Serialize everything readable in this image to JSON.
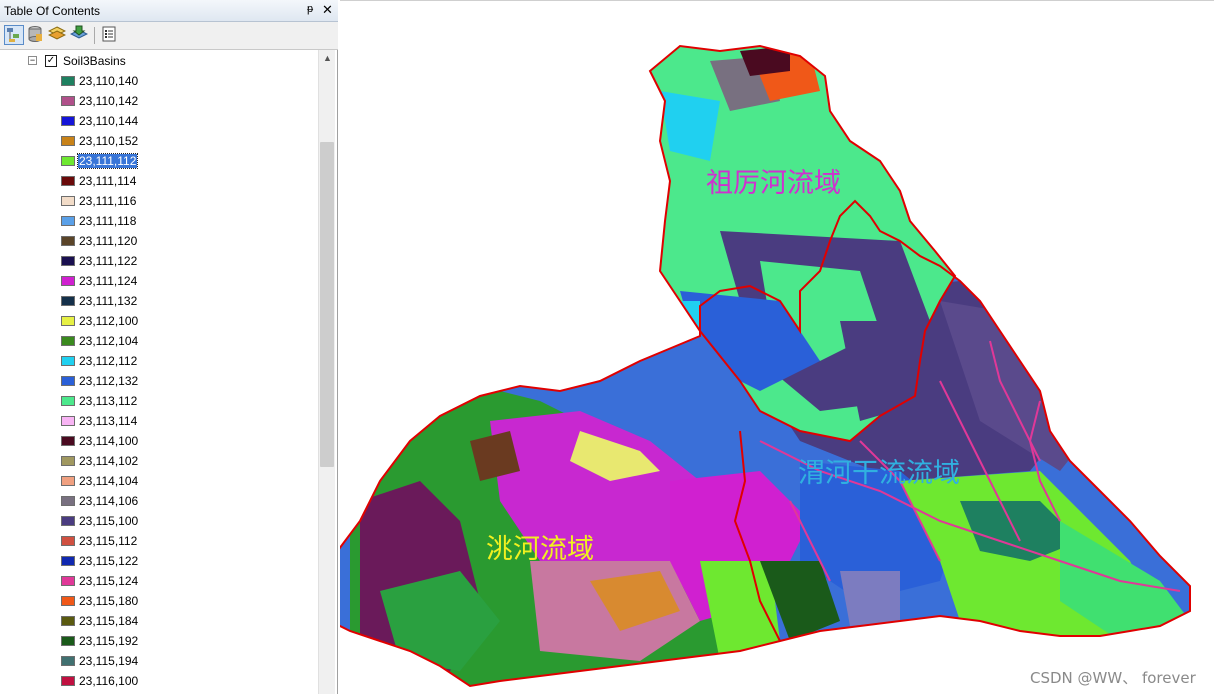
{
  "window": {
    "title": "Table Of Contents",
    "pin_glyph": "ᵽ",
    "close_glyph": "✕"
  },
  "toolbar": {
    "buttons": [
      {
        "icon": "list-by-drawing-order-icon",
        "active": true
      },
      {
        "icon": "list-by-source-icon",
        "active": false
      },
      {
        "icon": "list-by-visibility-icon",
        "active": false
      },
      {
        "icon": "list-by-selection-icon",
        "active": false
      },
      {
        "icon": "options-icon",
        "active": false
      }
    ]
  },
  "layer": {
    "name": "Soil3Basins",
    "checked": true,
    "expander_glyph": "−",
    "check_glyph": "✓"
  },
  "legend": [
    {
      "label": "23,110,140",
      "color": "#1e8060"
    },
    {
      "label": "23,110,142",
      "color": "#b0508a"
    },
    {
      "label": "23,110,144",
      "color": "#1414d8"
    },
    {
      "label": "23,110,152",
      "color": "#c88218"
    },
    {
      "label": "23,111,112",
      "color": "#6ee830",
      "selected": true
    },
    {
      "label": "23,111,114",
      "color": "#6a0a0a"
    },
    {
      "label": "23,111,116",
      "color": "#f2dcc8"
    },
    {
      "label": "23,111,118",
      "color": "#5aa0e8"
    },
    {
      "label": "23,111,120",
      "color": "#5a4428"
    },
    {
      "label": "23,111,122",
      "color": "#1a1050"
    },
    {
      "label": "23,111,124",
      "color": "#d020d0"
    },
    {
      "label": "23,111,132",
      "color": "#14304a"
    },
    {
      "label": "23,112,100",
      "color": "#e6f044"
    },
    {
      "label": "23,112,104",
      "color": "#3a8a1e"
    },
    {
      "label": "23,112,112",
      "color": "#20d0f0"
    },
    {
      "label": "23,112,132",
      "color": "#2a60d8"
    },
    {
      "label": "23,113,112",
      "color": "#4ce88c"
    },
    {
      "label": "23,113,114",
      "color": "#f8b4f4"
    },
    {
      "label": "23,114,100",
      "color": "#4a0a20"
    },
    {
      "label": "23,114,102",
      "color": "#a09860"
    },
    {
      "label": "23,114,104",
      "color": "#f0a080"
    },
    {
      "label": "23,114,106",
      "color": "#787080"
    },
    {
      "label": "23,115,100",
      "color": "#4a3c80"
    },
    {
      "label": "23,115,112",
      "color": "#d05040"
    },
    {
      "label": "23,115,122",
      "color": "#1028b0"
    },
    {
      "label": "23,115,124",
      "color": "#e03898"
    },
    {
      "label": "23,115,180",
      "color": "#f05818"
    },
    {
      "label": "23,115,184",
      "color": "#5a5a10"
    },
    {
      "label": "23,115,192",
      "color": "#1a5a1a"
    },
    {
      "label": "23,115,194",
      "color": "#407070"
    },
    {
      "label": "23,116,100",
      "color": "#c01040"
    }
  ],
  "map": {
    "labels": [
      {
        "text": "祖厉河流域",
        "color": "#d030d0"
      },
      {
        "text": "渭河干流流域",
        "color": "#30b0e0"
      },
      {
        "text": "洮河流域",
        "color": "#f0f020"
      }
    ],
    "boundary_color": "#e00000",
    "watermark": "CSDN @WW、 forever"
  }
}
